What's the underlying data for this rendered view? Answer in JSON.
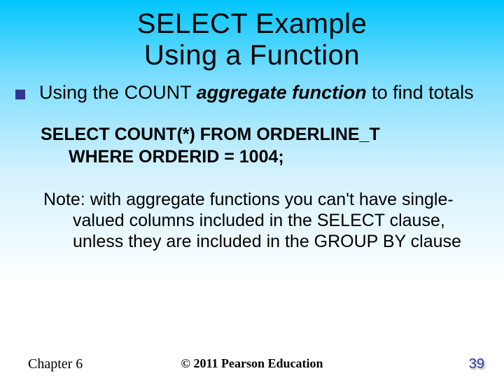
{
  "title_line1": "SELECT Example",
  "title_line2": "Using a Function",
  "bullet": {
    "pre": "Using the COUNT ",
    "emph": "aggregate function",
    "post": " to find totals"
  },
  "code": {
    "line1": "SELECT COUNT(*) FROM ORDERLINE_T",
    "line2": "WHERE ORDERID = 1004;"
  },
  "note": "Note: with aggregate functions you can't have single-valued columns included in the SELECT clause, unless they are included in the GROUP BY clause",
  "footer": {
    "left": "Chapter 6",
    "center": "© 2011 Pearson Education",
    "right": "39"
  }
}
